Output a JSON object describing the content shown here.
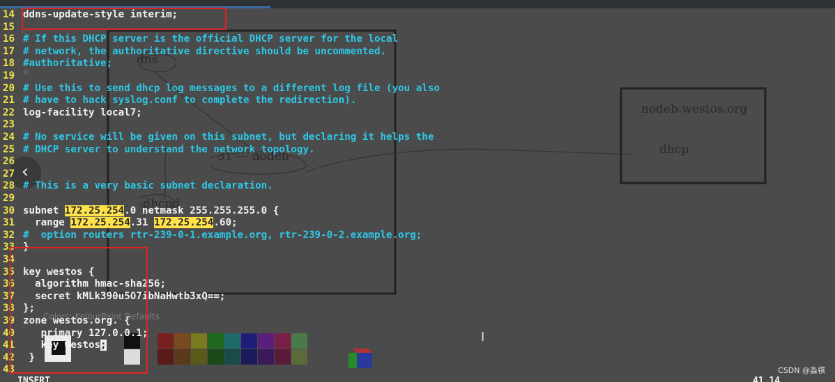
{
  "terminal": {
    "lines": [
      {
        "n": "14",
        "parts": [
          {
            "t": "ddns-update-style interim;",
            "c": "white"
          }
        ]
      },
      {
        "n": "15",
        "parts": []
      },
      {
        "n": "16",
        "parts": [
          {
            "t": "# If this DHCP server is the official DHCP server for the local",
            "c": "cyan"
          }
        ]
      },
      {
        "n": "17",
        "parts": [
          {
            "t": "# network, the authoritative directive should be uncommented.",
            "c": "cyan"
          }
        ]
      },
      {
        "n": "18",
        "parts": [
          {
            "t": "#authoritative;",
            "c": "cyan"
          }
        ]
      },
      {
        "n": "19",
        "parts": []
      },
      {
        "n": "20",
        "parts": [
          {
            "t": "# Use this to send dhcp log messages to a different log file (you also",
            "c": "cyan"
          }
        ]
      },
      {
        "n": "21",
        "parts": [
          {
            "t": "# have to hack syslog.conf to complete the redirection).",
            "c": "cyan"
          }
        ]
      },
      {
        "n": "22",
        "parts": [
          {
            "t": "log-facility local7;",
            "c": "white"
          }
        ]
      },
      {
        "n": "23",
        "parts": []
      },
      {
        "n": "24",
        "parts": [
          {
            "t": "# No service will be given on this subnet, but declaring it helps the",
            "c": "cyan"
          }
        ]
      },
      {
        "n": "25",
        "parts": [
          {
            "t": "# DHCP server to understand the network topology.",
            "c": "cyan"
          }
        ]
      },
      {
        "n": "26",
        "parts": []
      },
      {
        "n": "27",
        "parts": []
      },
      {
        "n": "28",
        "parts": [
          {
            "t": "# This is a very basic subnet declaration.",
            "c": "cyan"
          }
        ]
      },
      {
        "n": "29",
        "parts": []
      },
      {
        "n": "30",
        "parts": [
          {
            "t": "subnet ",
            "c": "white"
          },
          {
            "t": "172.25.254",
            "c": "hl"
          },
          {
            "t": ".0 netmask 255.255.255.0 {",
            "c": "white"
          }
        ]
      },
      {
        "n": "31",
        "parts": [
          {
            "t": "  range ",
            "c": "white"
          },
          {
            "t": "172.25.254",
            "c": "hl"
          },
          {
            "t": ".31 ",
            "c": "white"
          },
          {
            "t": "172.25.254",
            "c": "hl"
          },
          {
            "t": ".60;",
            "c": "white"
          }
        ]
      },
      {
        "n": "32",
        "parts": [
          {
            "t": "#  option routers rtr-239-0-1.example.org, rtr-239-0-2.example.org;",
            "c": "cyan"
          }
        ]
      },
      {
        "n": "33",
        "parts": [
          {
            "t": "}",
            "c": "white"
          }
        ]
      },
      {
        "n": "34",
        "parts": []
      },
      {
        "n": "35",
        "parts": [
          {
            "t": "key westos {",
            "c": "white"
          }
        ]
      },
      {
        "n": "36",
        "parts": [
          {
            "t": "  algorithm hmac-sha256;",
            "c": "white"
          }
        ]
      },
      {
        "n": "37",
        "parts": [
          {
            "t": "  secret kMLk390u5O7ibNaHwtb3xQ==;",
            "c": "white"
          }
        ]
      },
      {
        "n": "38",
        "parts": [
          {
            "t": "};",
            "c": "white"
          }
        ]
      },
      {
        "n": "39",
        "parts": [
          {
            "t": "zone westos.org. {",
            "c": "white"
          }
        ]
      },
      {
        "n": "40",
        "parts": [
          {
            "t": "   primary 127.0.0.1;",
            "c": "white"
          }
        ]
      },
      {
        "n": "41",
        "parts": [
          {
            "t": "   key westos",
            "c": "white"
          },
          {
            "t": ";",
            "c": "cursor"
          }
        ]
      },
      {
        "n": "42",
        "parts": [
          {
            "t": " }",
            "c": "white"
          }
        ]
      },
      {
        "n": "43",
        "parts": []
      }
    ],
    "mode": "INSERT",
    "cursor_pos": "41,14"
  },
  "paint_background": {
    "labels": {
      "dns": "dns",
      "node_link": "31  ---  nodeb",
      "dhcpd": "dhcpd",
      "nodeb_host": "nodeb.westos.org",
      "dhcp": "dhcp"
    },
    "colors_label": "Colors: KolourPaint Defaults",
    "palette": [
      "#7a1f1f",
      "#7a4a1f",
      "#7a7a1f",
      "#1f6a1f",
      "#1f6a6a",
      "#1f1f7a",
      "#5a1f7a",
      "#7a1f4a",
      "#4a7a4a",
      "#5a1a1a",
      "#5a3a1a",
      "#5a5a1a",
      "#1a4a1a",
      "#1a4a4a",
      "#1a1a5a",
      "#3a1a5a",
      "#5a1a3a",
      "#5a6a3a"
    ]
  },
  "watermark": "CSDN @淼祺",
  "colors": {
    "annotation": "#e02424",
    "comment": "#2ec7e6",
    "line_number": "#f2e24a",
    "highlight": "#ffe24a"
  }
}
